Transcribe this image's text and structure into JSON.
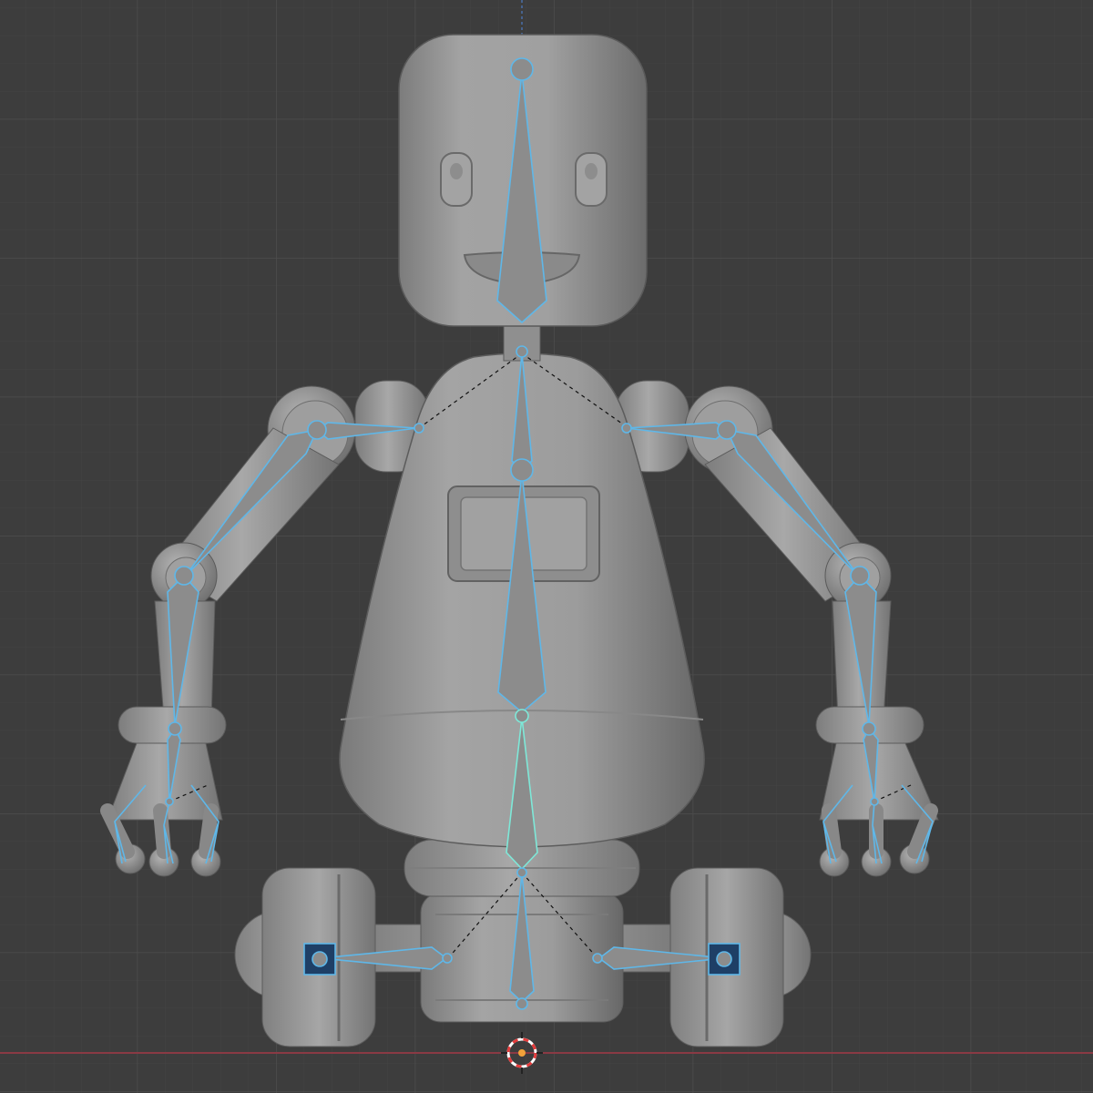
{
  "viewport": {
    "mode": "pose",
    "view": "front-orthographic",
    "background_color": "#3d3d3d",
    "grid_minor_color": "#444444",
    "grid_major_color": "#4e4e4e",
    "x_axis_color": "#8a3a44",
    "z_axis_color": "#4a6ea8"
  },
  "model": {
    "name_visible": false,
    "mesh_color": "#9a9a9a",
    "mesh_shadow": "#6e6e6e",
    "mesh_highlight": "#b8b8b8"
  },
  "armature": {
    "bone_color": "#8c8c8c",
    "bone_outline": "#5fb7e8",
    "active_bone_outline": "#7ee8d8",
    "relation_line_color": "#111111",
    "selected_handle_color": "#1e3f66"
  },
  "cursor": {
    "icon": "3d-cursor-icon",
    "ring_color_a": "#e43a3a",
    "ring_color_b": "#ffffff",
    "center_color": "#f2a23a"
  }
}
